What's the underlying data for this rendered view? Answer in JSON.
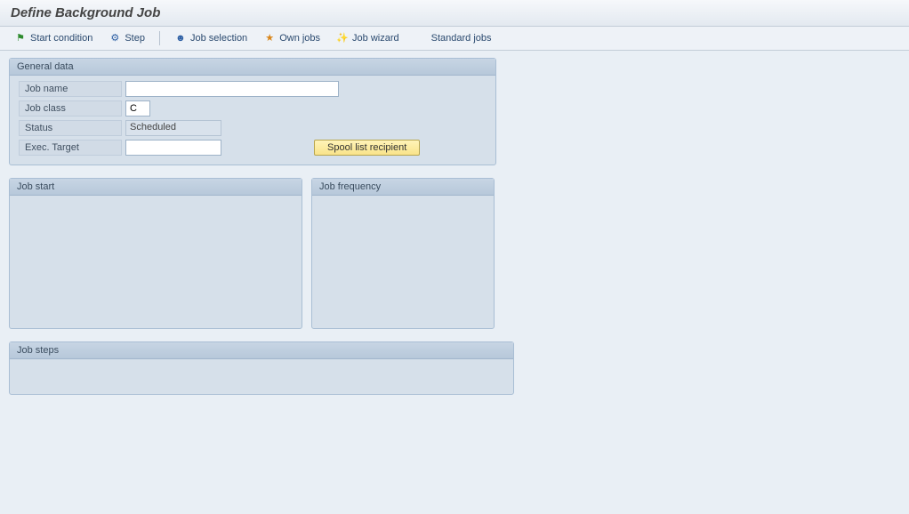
{
  "title": "Define Background Job",
  "toolbar": {
    "start_condition": "Start condition",
    "step": "Step",
    "job_selection": "Job selection",
    "own_jobs": "Own jobs",
    "job_wizard": "Job wizard",
    "standard_jobs": "Standard jobs"
  },
  "general": {
    "group_title": "General data",
    "job_name_label": "Job name",
    "job_name_value": "",
    "job_class_label": "Job class",
    "job_class_value": "C",
    "status_label": "Status",
    "status_value": "Scheduled",
    "exec_target_label": "Exec. Target",
    "exec_target_value": "",
    "spool_button_label": "Spool list recipient"
  },
  "job_start": {
    "group_title": "Job start"
  },
  "job_frequency": {
    "group_title": "Job frequency"
  },
  "job_steps": {
    "group_title": "Job steps"
  },
  "icons": {
    "flag": "⚑",
    "step": "⚙",
    "selection": "☻",
    "own_jobs": "★",
    "wizard": "✨",
    "standard": " "
  },
  "colors": {
    "icon_green": "#2e8b2e",
    "icon_blue": "#2d5fa4",
    "icon_orange": "#d9861a",
    "icon_gold": "#c79a12"
  }
}
